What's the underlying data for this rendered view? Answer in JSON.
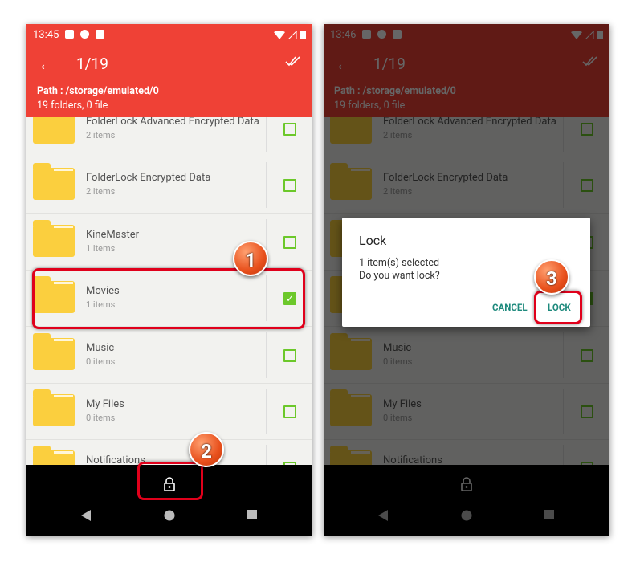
{
  "left": {
    "time": "13:45",
    "title": "1/19",
    "path": "Path : /storage/emulated/0",
    "summary": "19 folders, 0 file"
  },
  "right": {
    "time": "13:46",
    "title": "1/19",
    "path": "Path : /storage/emulated/0",
    "summary": "19 folders, 0 file"
  },
  "folders": [
    {
      "name": "FolderLock Advanced Encrypted Data",
      "sub": "2 items",
      "checked": false
    },
    {
      "name": "FolderLock Encrypted Data",
      "sub": "2 items",
      "checked": false
    },
    {
      "name": "KineMaster",
      "sub": "1 items",
      "checked": false
    },
    {
      "name": "Movies",
      "sub": "1 items",
      "checked": true
    },
    {
      "name": "Music",
      "sub": "0 items",
      "checked": false
    },
    {
      "name": "My Files",
      "sub": "0 items",
      "checked": false
    },
    {
      "name": "Notifications",
      "sub": "",
      "checked": false
    }
  ],
  "dialog": {
    "title": "Lock",
    "line1": "1 item(s) selected",
    "line2": "Do you want lock?",
    "cancel": "CANCEL",
    "lock": "LOCK"
  },
  "badges": [
    "1",
    "2",
    "3"
  ],
  "colors": {
    "accent": "#ef4136",
    "checkbox": "#6cc82a",
    "dialog_button": "#1e8a7d",
    "highlight": "#e0001b"
  }
}
